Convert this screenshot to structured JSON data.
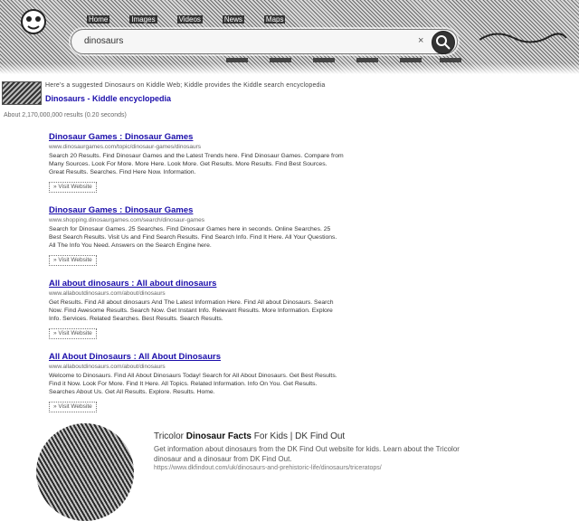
{
  "header": {
    "nav_items": [
      "Home",
      "Images",
      "Videos",
      "News",
      "Maps"
    ],
    "search_value": "dinosaurs"
  },
  "promo": {
    "subtitle": "Here's a suggested Dinosaurs on Kiddle Web; Kiddle provides the Kiddle search encyclopedia",
    "title": "Dinosaurs - Kiddle encyclopedia"
  },
  "stats_text": "About 2,170,000,000 results (0.20 seconds)",
  "results": [
    {
      "title": "Dinosaur Games : Dinosaur Games",
      "url": "www.dinosaurgames.com/topic/dinosaur-games/dinosaurs",
      "desc": "Search 20 Results. Find Dinosaur Games and the Latest Trends here. Find Dinosaur Games. Compare from Many Sources. Look For More. More Here. Look More. Get Results. More Results. Find Best Sources. Great Results. Searches. Find Here Now. Information.",
      "button": "» Visit Website"
    },
    {
      "title": "Dinosaur Games : Dinosaur Games",
      "url": "www.shopping.dinosaurgames.com/search/dinosaur-games",
      "desc": "Search for Dinosaur Games. 25 Searches. Find Dinosaur Games here in seconds. Online Searches. 25 Best Search Results. Visit Us and Find Search Results. Find Search Info. Find It Here. All Your Questions. All The Info You Need. Answers on the Search Engine here.",
      "button": "» Visit Website"
    },
    {
      "title": "All about dinosaurs : All about dinosaurs",
      "url": "www.allaboutdinosaurs.com/about/dinosaurs",
      "desc": "Get Results. Find All about dinosaurs And The Latest Information Here. Find All about Dinosaurs. Search Now. Find Awesome Results. Search Now. Get Instant Info. Relevant Results. More Information. Explore Info. Services. Related Searches. Best Results. Search Results.",
      "button": "» Visit Website"
    },
    {
      "title": "All About Dinosaurs : All About Dinosaurs",
      "url": "www.allaboutdinosaurs.com/about/dinosaurs",
      "desc": "Welcome to Dinosaurs. Find All About Dinosaurs Today! Search for All About Dinosaurs. Get Best Results. Find it Now. Look For More. Find It Here. All Topics. Related Information. Info On You. Get Results. Searches About Us. Get All Results. Explore. Results. Home.",
      "button": "» Visit Website"
    }
  ],
  "feature": {
    "title_pre": "Tricolor",
    "title_bold": "Dinosaur Facts",
    "title_post": "For Kids | DK Find Out",
    "desc": "Get information about dinosaurs from the DK Find Out website for kids. Learn about the Tricolor dinosaur and a dinosaur from DK Find Out.",
    "url": "https://www.dkfindout.com/uk/dinosaurs-and-prehistoric-life/dinosaurs/triceratops/"
  }
}
